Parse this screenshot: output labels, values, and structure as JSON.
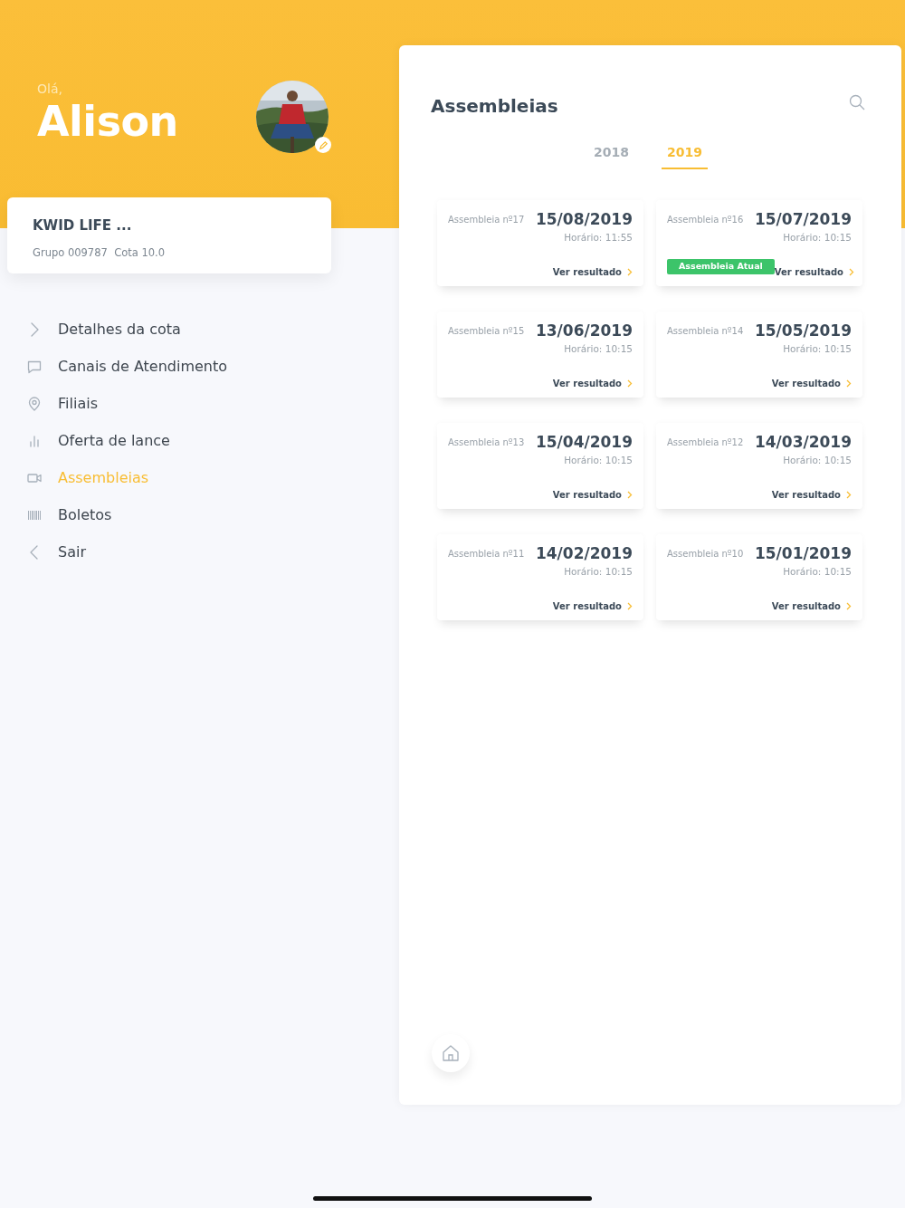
{
  "greeting": "Olá,",
  "user_name": "Alison",
  "quota_card": {
    "title": "KWID LIFE ...",
    "group": "Grupo 009787",
    "quota": "Cota 10.0"
  },
  "menu": [
    {
      "label": "Detalhes da cota",
      "selected": false
    },
    {
      "label": "Canais de Atendimento",
      "selected": false
    },
    {
      "label": "Filiais",
      "selected": false
    },
    {
      "label": "Oferta de lance",
      "selected": false
    },
    {
      "label": "Assembleias",
      "selected": true
    },
    {
      "label": "Boletos",
      "selected": false
    },
    {
      "label": "Sair",
      "selected": false
    }
  ],
  "panel": {
    "title": "Assembleias",
    "tabs": [
      {
        "label": "2018",
        "selected": false
      },
      {
        "label": "2019",
        "selected": true
      }
    ],
    "assemblies": [
      {
        "name": "Assembleia nº17",
        "date": "15/08/2019",
        "time": "Horário: 11:55",
        "link": "Ver resultado"
      },
      {
        "name": "Assembleia nº16",
        "date": "15/07/2019",
        "time": "Horário: 10:15",
        "badge": "Assembleia Atual",
        "link": "Ver resultado"
      },
      {
        "name": "Assembleia nº15",
        "date": "13/06/2019",
        "time": "Horário: 10:15",
        "link": "Ver resultado"
      },
      {
        "name": "Assembleia nº14",
        "date": "15/05/2019",
        "time": "Horário: 10:15",
        "link": "Ver resultado"
      },
      {
        "name": "Assembleia nº13",
        "date": "15/04/2019",
        "time": "Horário: 10:15",
        "link": "Ver resultado"
      },
      {
        "name": "Assembleia nº12",
        "date": "14/03/2019",
        "time": "Horário: 10:15",
        "link": "Ver resultado"
      },
      {
        "name": "Assembleia nº11",
        "date": "14/02/2019",
        "time": "Horário: 10:15",
        "link": "Ver resultado"
      },
      {
        "name": "Assembleia nº10",
        "date": "15/01/2019",
        "time": "Horário: 10:15",
        "link": "Ver resultado"
      }
    ]
  }
}
